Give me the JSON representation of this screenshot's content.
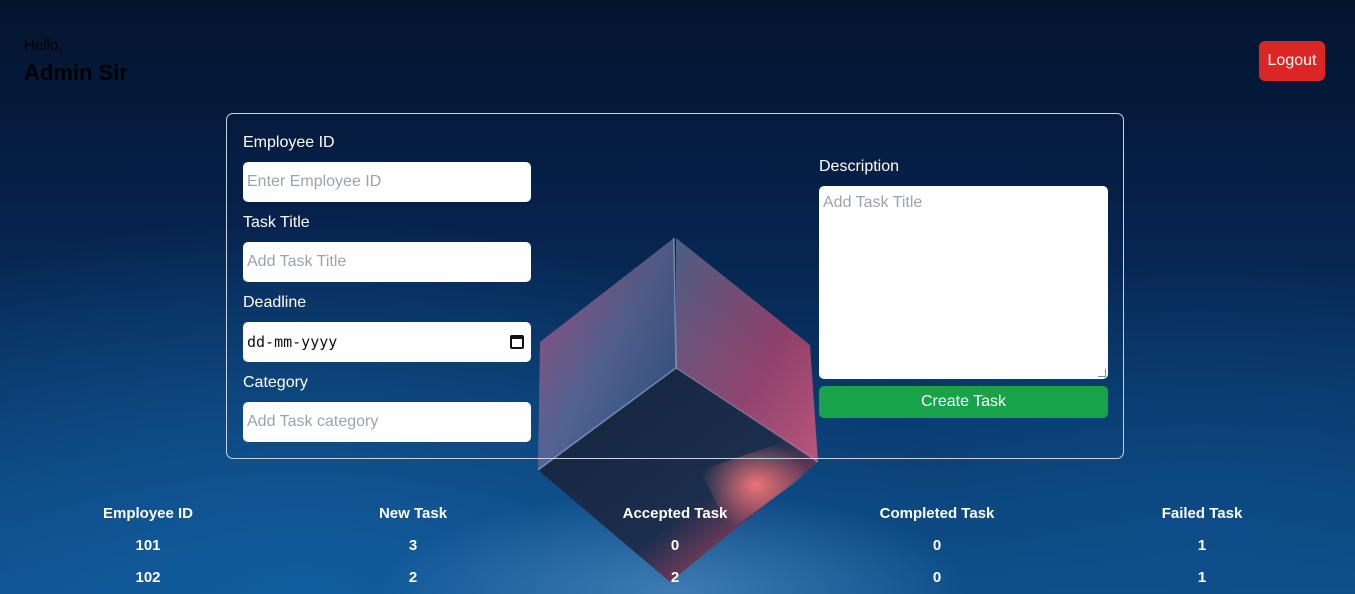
{
  "header": {
    "greeting": "Hello,",
    "user_name": "Admin Sir",
    "logout_label": "Logout"
  },
  "form": {
    "employee_id": {
      "label": "Employee ID",
      "placeholder": "Enter Employee ID"
    },
    "task_title": {
      "label": "Task Title",
      "placeholder": "Add Task Title"
    },
    "deadline": {
      "label": "Deadline",
      "value": "dd-mm-yyyy"
    },
    "category": {
      "label": "Category",
      "placeholder": "Add Task category"
    },
    "description": {
      "label": "Description",
      "placeholder": "Add Task Title"
    },
    "submit_label": "Create Task"
  },
  "stats": {
    "headers": [
      "Employee ID",
      "New Task",
      "Accepted Task",
      "Completed Task",
      "Failed Task"
    ],
    "rows": [
      [
        "101",
        "3",
        "0",
        "0",
        "1"
      ],
      [
        "102",
        "2",
        "2",
        "0",
        "1"
      ]
    ]
  },
  "colors": {
    "logout": "#dc2626",
    "create": "#16a34a"
  }
}
